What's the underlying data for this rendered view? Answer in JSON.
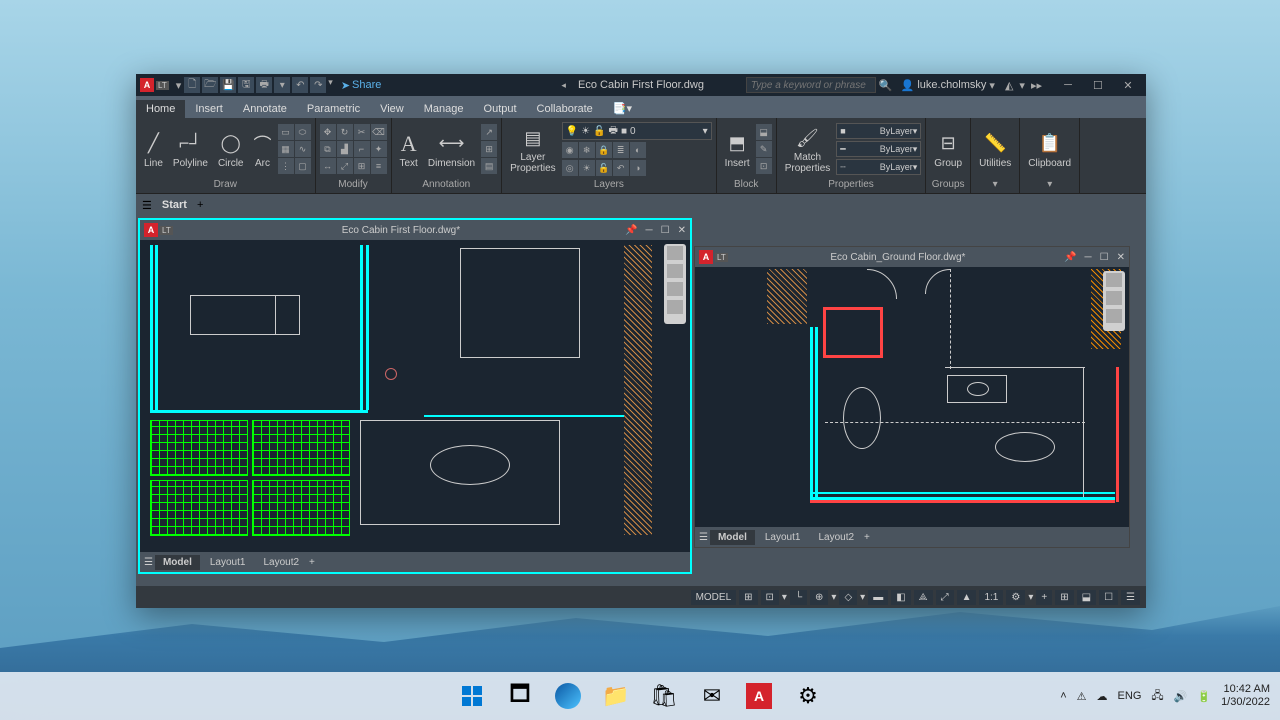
{
  "app": {
    "title": "Eco Cabin First Floor.dwg",
    "share": "Share",
    "search_placeholder": "Type a keyword or phrase",
    "user": "luke.cholmsky"
  },
  "tabs": [
    "Home",
    "Insert",
    "Annotate",
    "Parametric",
    "View",
    "Manage",
    "Output",
    "Collaborate"
  ],
  "ribbon": {
    "draw": {
      "title": "Draw",
      "line": "Line",
      "polyline": "Polyline",
      "circle": "Circle",
      "arc": "Arc"
    },
    "modify": {
      "title": "Modify"
    },
    "annotation": {
      "title": "Annotation",
      "text": "Text",
      "dimension": "Dimension"
    },
    "layers": {
      "title": "Layers",
      "properties": "Layer\nProperties",
      "current": "0"
    },
    "block": {
      "title": "Block",
      "insert": "Insert"
    },
    "properties": {
      "title": "Properties",
      "match": "Match\nProperties",
      "bylayer": "ByLayer"
    },
    "groups": {
      "title": "Groups",
      "group": "Group"
    },
    "utilities": {
      "title": "Utilities"
    },
    "clipboard": {
      "title": "Clipboard"
    }
  },
  "start": {
    "label": "Start"
  },
  "doc1": {
    "title": "Eco Cabin First Floor.dwg*",
    "tabs": {
      "model": "Model",
      "l1": "Layout1",
      "l2": "Layout2"
    }
  },
  "doc2": {
    "title": "Eco Cabin_Ground Floor.dwg*",
    "tabs": {
      "model": "Model",
      "l1": "Layout1",
      "l2": "Layout2"
    }
  },
  "status": {
    "model": "MODEL",
    "scale": "1:1"
  },
  "taskbar": {
    "lang": "ENG",
    "time": "10:42 AM",
    "date": "1/30/2022"
  }
}
